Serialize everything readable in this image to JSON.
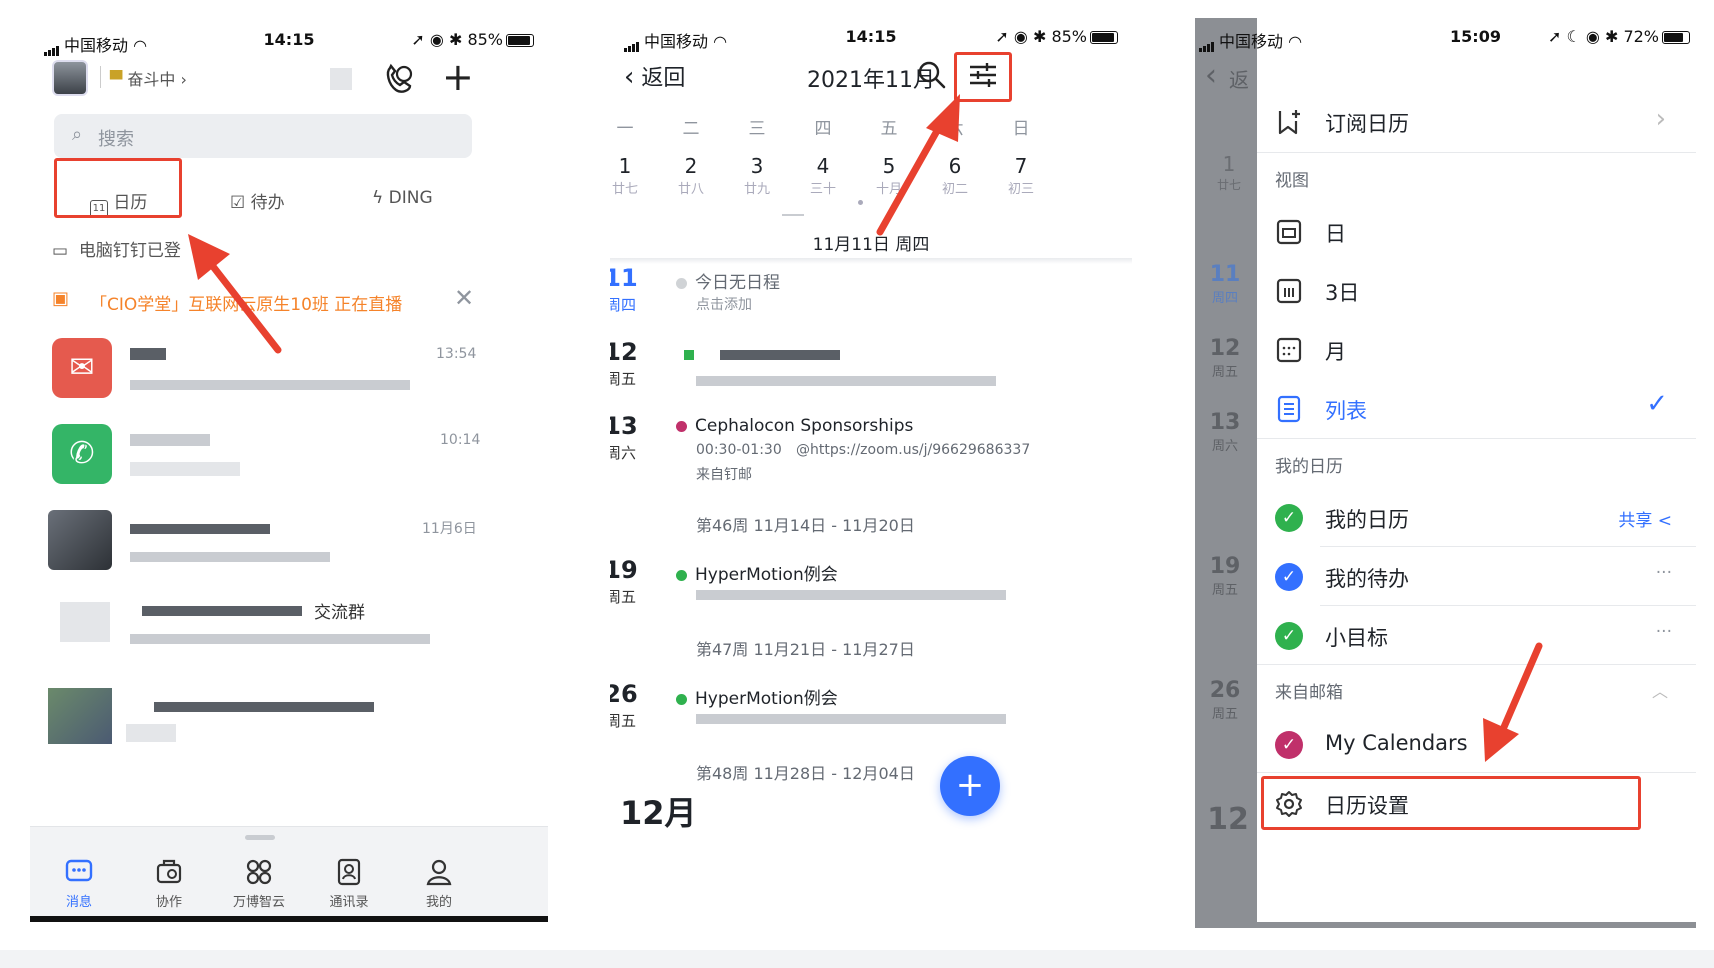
{
  "panel1": {
    "status": {
      "carrier": "中国移动",
      "time": "14:15",
      "battery": "85%"
    },
    "header": {
      "status_label": "奋斗中",
      "status_chevron": "›"
    },
    "search": {
      "placeholder": "搜索"
    },
    "quick_actions": [
      {
        "label": "日历",
        "icon": "calendar-icon"
      },
      {
        "label": "待办",
        "icon": "todo-icon"
      },
      {
        "label": "DING",
        "icon": "lightning-icon"
      }
    ],
    "desktop_notice": "电脑钉钉已登",
    "live_banner": "「CIO学堂」互联网云原生10班 正在直播",
    "messages": [
      {
        "time": "13:54"
      },
      {
        "time": "10:14"
      },
      {
        "time": "11月6日"
      },
      {
        "title_fragment": "交流群"
      }
    ],
    "tabbar": [
      {
        "label": "消息",
        "icon": "message-icon"
      },
      {
        "label": "协作",
        "icon": "collaboration-icon"
      },
      {
        "label": "万博智云",
        "icon": "apps-icon"
      },
      {
        "label": "通讯录",
        "icon": "contacts-icon"
      },
      {
        "label": "我的",
        "icon": "profile-icon"
      }
    ]
  },
  "panel2": {
    "status": {
      "carrier": "中国移动",
      "time": "14:15",
      "battery": "85%"
    },
    "nav": {
      "back_label": "返回",
      "title": "2021年11月"
    },
    "weekdays": [
      "一",
      "二",
      "三",
      "四",
      "五",
      "六",
      "日"
    ],
    "dates": [
      {
        "day": "1",
        "lunar": "廿七"
      },
      {
        "day": "2",
        "lunar": "廿八"
      },
      {
        "day": "3",
        "lunar": "廿九"
      },
      {
        "day": "4",
        "lunar": "三十"
      },
      {
        "day": "5",
        "lunar": "十月"
      },
      {
        "day": "6",
        "lunar": "初二"
      },
      {
        "day": "7",
        "lunar": "初三"
      }
    ],
    "selected_date": "11月11日 周四",
    "agenda": [
      {
        "day": "11",
        "weekday": "周四",
        "title": "今日无日程",
        "subtitle": "点击添加"
      },
      {
        "day": "12",
        "weekday": "周五"
      },
      {
        "day": "13",
        "weekday": "周六",
        "title": "Cephalocon Sponsorships",
        "time": "00:30-01:30",
        "location": "@https://zoom.us/j/96629686337",
        "source": "来自钉邮",
        "color": "#c0306a"
      },
      {
        "week_label": "第46周 11月14日 - 11月20日"
      },
      {
        "day": "19",
        "weekday": "周五",
        "title": "HyperMotion例会",
        "color": "#2fb14e"
      },
      {
        "week_label": "第47周 11月21日 - 11月27日"
      },
      {
        "day": "26",
        "weekday": "周五",
        "title": "HyperMotion例会",
        "color": "#2fb14e"
      },
      {
        "week_label": "第48周 11月28日 - 12月04日"
      }
    ],
    "month_header": "12月",
    "fab_label": "+"
  },
  "panel3": {
    "status": {
      "carrier": "中国移动",
      "time": "15:09",
      "battery": "72%"
    },
    "back_fragment": "返",
    "bg_days": [
      {
        "day": "1",
        "sub": "廿七"
      },
      {
        "day": "11",
        "sub": "周四"
      },
      {
        "day": "12",
        "sub": "周五"
      },
      {
        "day": "13",
        "sub": "周六"
      },
      {
        "day": "19",
        "sub": "周五"
      },
      {
        "day": "26",
        "sub": "周五"
      },
      {
        "day": "12",
        "sub": ""
      }
    ],
    "menu": {
      "subscribe_label": "订阅日历",
      "view_header": "视图",
      "views": [
        {
          "label": "日",
          "icon": "day-view-icon"
        },
        {
          "label": "3日",
          "icon": "three-day-view-icon"
        },
        {
          "label": "月",
          "icon": "month-view-icon"
        },
        {
          "label": "列表",
          "icon": "list-view-icon",
          "selected": true
        }
      ],
      "my_header": "我的日历",
      "my_calendars": [
        {
          "label": "我的日历",
          "color": "#2fb14e",
          "action": "共享"
        },
        {
          "label": "我的待办",
          "color": "#3370ff",
          "action": "···"
        },
        {
          "label": "小目标",
          "color": "#2fb14e",
          "action": "···"
        }
      ],
      "mail_header": "来自邮箱",
      "mail_calendars": [
        {
          "label": "My Calendars",
          "color": "#c0306a"
        }
      ],
      "settings_label": "日历设置"
    }
  },
  "colors": {
    "accent": "#3370ff",
    "highlight": "#e8412f",
    "orange": "#f5832a"
  }
}
